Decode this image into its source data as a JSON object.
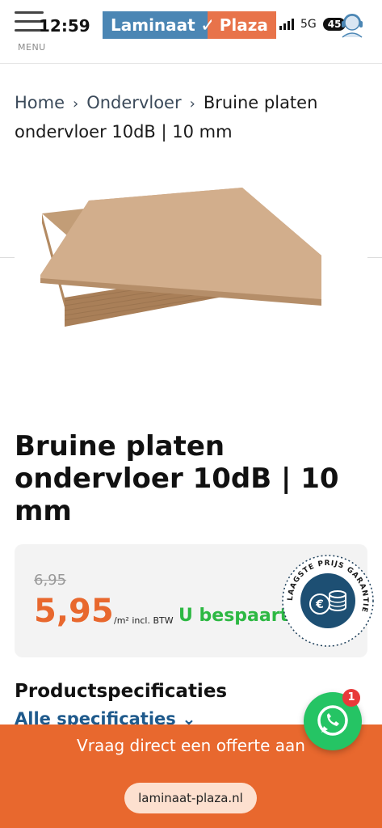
{
  "status_bar": {
    "time": "12:59",
    "network": "5G",
    "battery": "45"
  },
  "header": {
    "menu_label": "MENU",
    "logo_left": "Laminaat",
    "logo_check": "✓",
    "logo_right": "Plaza"
  },
  "breadcrumb": {
    "items": [
      "Home",
      "Ondervloer"
    ],
    "separator": "›",
    "current": "Bruine platen ondervloer 10dB | 10 mm"
  },
  "product": {
    "title": "Bruine platen ondervloer 10dB | 10 mm",
    "old_price": "6,95",
    "price": "5,95",
    "price_unit": "/m² incl. BTW",
    "saving_label": "U bespaart",
    "badge_text": "LAAGSTE PRIJS GARANTIE"
  },
  "specs": {
    "title": "Productspecificaties",
    "all_link": "Alle specificaties"
  },
  "bottom_bar": {
    "offer_text": "Vraag direct een offerte aan",
    "url": "laminaat-plaza.nl"
  },
  "whatsapp": {
    "badge_count": "1"
  },
  "colors": {
    "accent_orange": "#e8682e",
    "brand_blue": "#4b86b4",
    "saving_green": "#2db843",
    "link_blue": "#1f5a8c"
  }
}
